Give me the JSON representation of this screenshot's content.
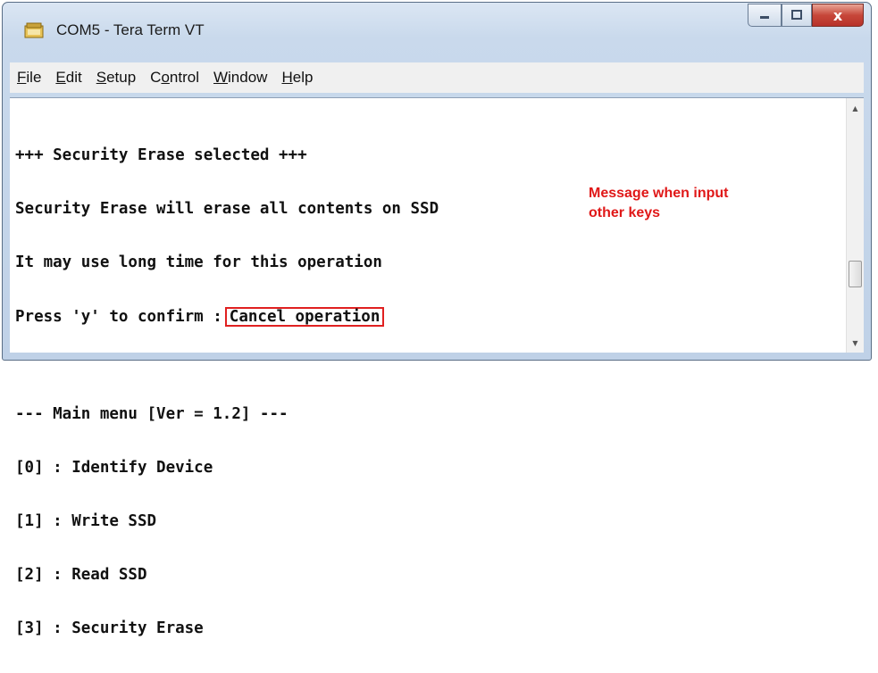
{
  "window": {
    "title": "COM5 - Tera Term VT",
    "controls": {
      "minimize": "minimize-button",
      "maximize": "maximize-button",
      "close": "x"
    }
  },
  "menu": {
    "items": [
      {
        "label": "File",
        "mnemonic": "F"
      },
      {
        "label": "Edit",
        "mnemonic": "E"
      },
      {
        "label": "Setup",
        "mnemonic": "S"
      },
      {
        "label": "Control",
        "mnemonic": "o"
      },
      {
        "label": "Window",
        "mnemonic": "W"
      },
      {
        "label": "Help",
        "mnemonic": "H"
      }
    ]
  },
  "terminal": {
    "lines": [
      "+++ Security Erase selected +++",
      "Security Erase will erase all contents on SSD",
      "It may use long time for this operation",
      "Press 'y' to confirm :"
    ],
    "highlighted": "Cancel operation",
    "menu_lines": [
      "--- Main menu [Ver = 1.2] ---",
      "[0] : Identify Device",
      "[1] : Write SSD",
      "[2] : Read SSD",
      "[3] : Security Erase"
    ]
  },
  "annotation": {
    "line1": "Message when input",
    "line2": "other keys"
  },
  "colors": {
    "annotation": "#e01818",
    "titlebar": "#c9d9ec",
    "close_button": "#c7473a"
  }
}
